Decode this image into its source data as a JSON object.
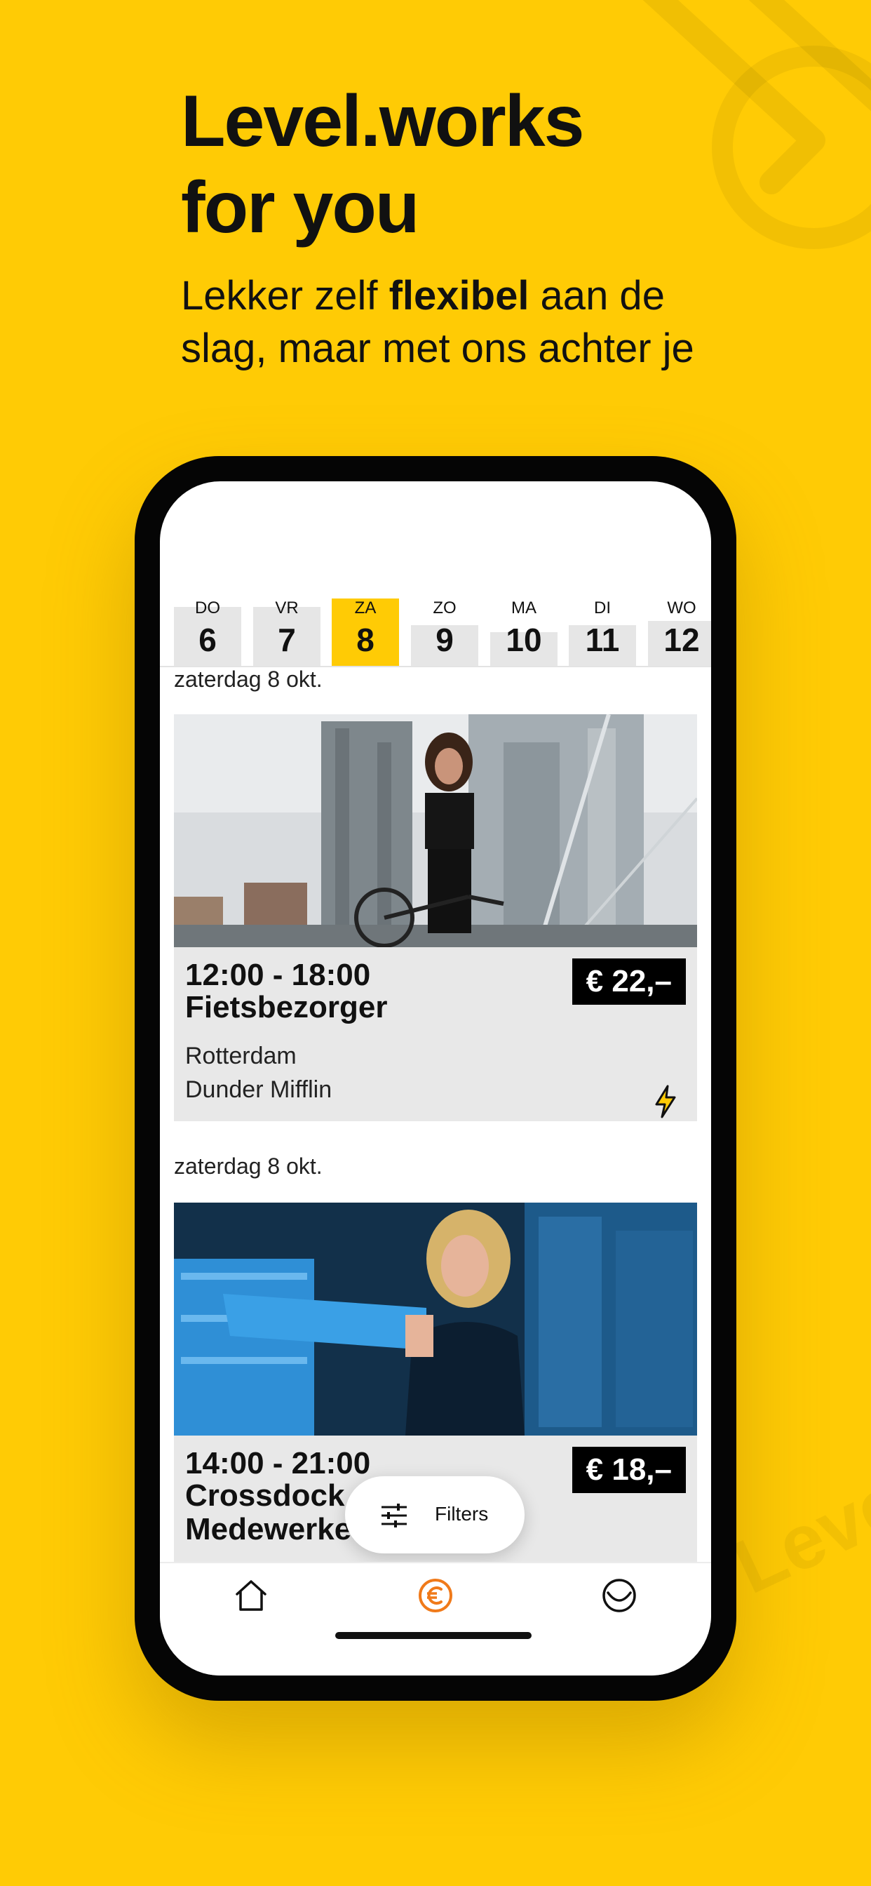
{
  "headline": {
    "line1": "Level.works",
    "line2": "for you"
  },
  "subheadline": {
    "part1": "Lekker zelf ",
    "bold": "flexibel",
    "part2": " aan de",
    "line2": "slag, maar met ons achter je"
  },
  "watermark": "Level.",
  "days": [
    {
      "weekday": "DO",
      "day": "6"
    },
    {
      "weekday": "VR",
      "day": "7"
    },
    {
      "weekday": "ZA",
      "day": "8",
      "active": true
    },
    {
      "weekday": "ZO",
      "day": "9"
    },
    {
      "weekday": "MA",
      "day": "10"
    },
    {
      "weekday": "DI",
      "day": "11"
    },
    {
      "weekday": "WO",
      "day": "12"
    }
  ],
  "jobs": [
    {
      "date_header": "zaterdag 8 okt.",
      "time": "12:00 - 18:00",
      "role": "Fietsbezorger",
      "price": "€ 22,–",
      "city": "Rotterdam",
      "company": "Dunder Mifflin",
      "photo": "woman-with-bicycle-city-photo"
    },
    {
      "date_header": "zaterdag 8 okt.",
      "time": "14:00 - 21:00",
      "role_line1": "Crossdock",
      "role_line2": "Medewerker",
      "price": "€ 18,–",
      "photo": "woman-with-blue-crates-photo"
    }
  ],
  "filters_label": "Filters",
  "tabs": [
    {
      "icon": "home-icon"
    },
    {
      "icon": "euro-icon",
      "active": true
    },
    {
      "icon": "smiley-icon"
    }
  ],
  "colors": {
    "brand_yellow": "#FFCB05",
    "active_tab": "#F07A1A",
    "black": "#000000"
  }
}
